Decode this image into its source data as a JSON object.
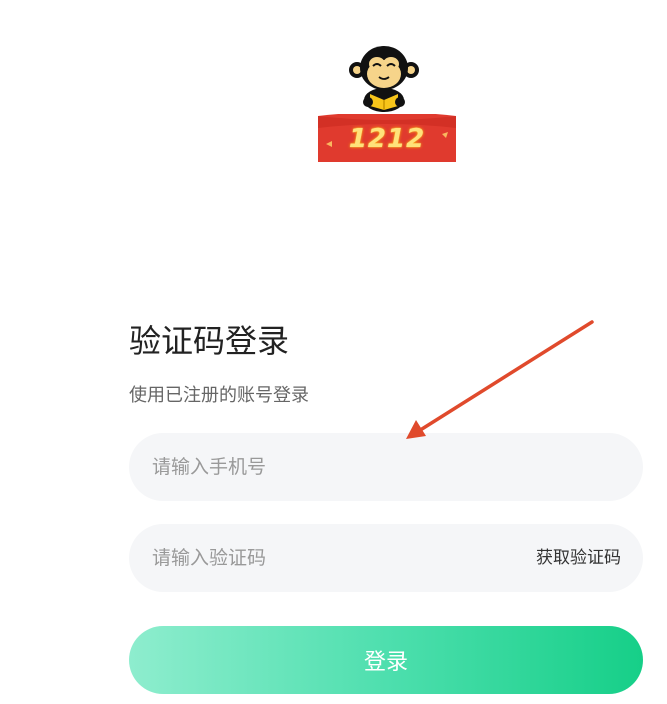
{
  "logo": {
    "icon": "monkey-mascot-icon",
    "banner_text": "1212",
    "banner_color": "#e03a2e"
  },
  "login": {
    "title": "验证码登录",
    "subtitle": "使用已注册的账号登录",
    "phone_placeholder": "请输入手机号",
    "code_placeholder": "请输入验证码",
    "get_code_label": "获取验证码",
    "submit_label": "登录"
  },
  "annotation": {
    "icon": "red-arrow-icon",
    "color": "#e04a2c"
  },
  "colors": {
    "accent_start": "#8eedce",
    "accent_end": "#16cf88",
    "field_bg": "#f5f6f8"
  }
}
